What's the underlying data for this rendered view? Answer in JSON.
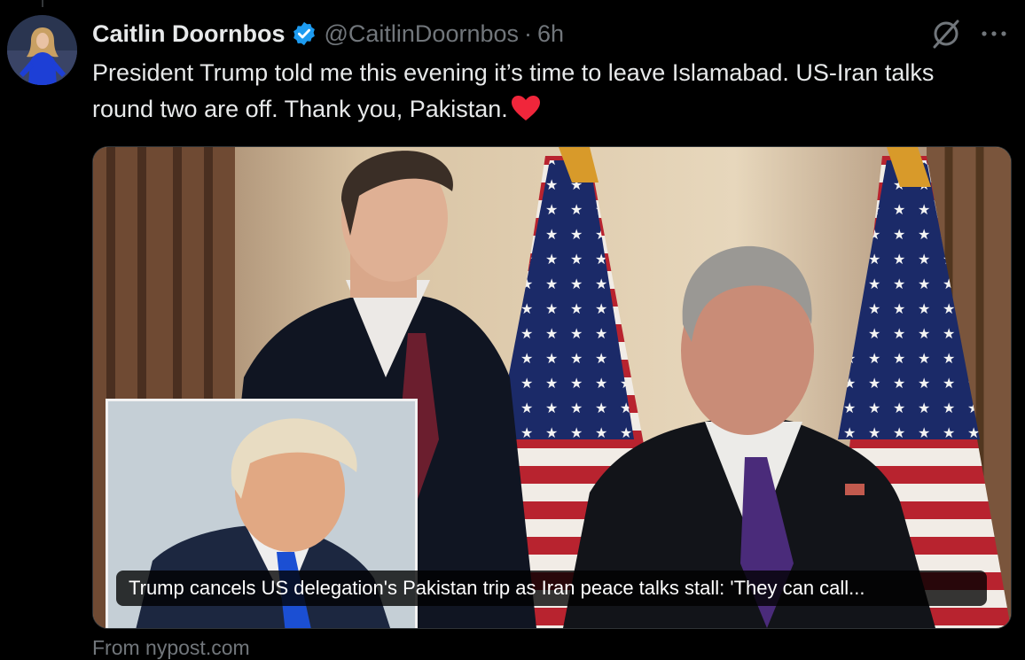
{
  "tweet": {
    "author_name": "Caitlin Doornbos",
    "handle": "@CaitlinDoornbos",
    "separator": "·",
    "time": "6h",
    "text": "President Trump told me this evening it’s time to leave Islamabad. US-Iran talks round two are off. Thank you, Pakistan."
  },
  "card": {
    "caption": "Trump cancels US delegation's Pakistan trip as Iran peace talks stall: 'They can call...",
    "source": "From nypost.com"
  },
  "icons": {
    "verified": "verified-badge-icon",
    "grok": "grok-icon",
    "more": "more-icon",
    "heart": "heart-emoji"
  },
  "colors": {
    "verified_blue": "#1d9bf0",
    "heart_red": "#f0263b",
    "muted": "#71767b"
  }
}
